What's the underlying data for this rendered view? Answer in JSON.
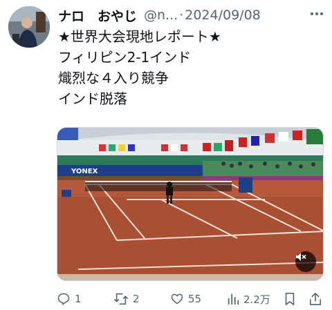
{
  "author": {
    "display_name": "ナロ　おやじ",
    "handle": "@n...",
    "separator": "·",
    "date": "2024/09/08"
  },
  "tweet": {
    "lines": [
      "★世界大会現地レポート★",
      "フィリピン2-1インド",
      "熾烈な４入り競争",
      "インド脱落"
    ]
  },
  "media": {
    "banner_text": "YONEX",
    "mute_icon": "speaker-muted-icon"
  },
  "actions": {
    "reply_count": "1",
    "retweet_count": "2",
    "like_count": "55",
    "view_count": "2.2万"
  },
  "colors": {
    "text": "#0f1419",
    "secondary": "#536471",
    "court": "#b5593a"
  }
}
